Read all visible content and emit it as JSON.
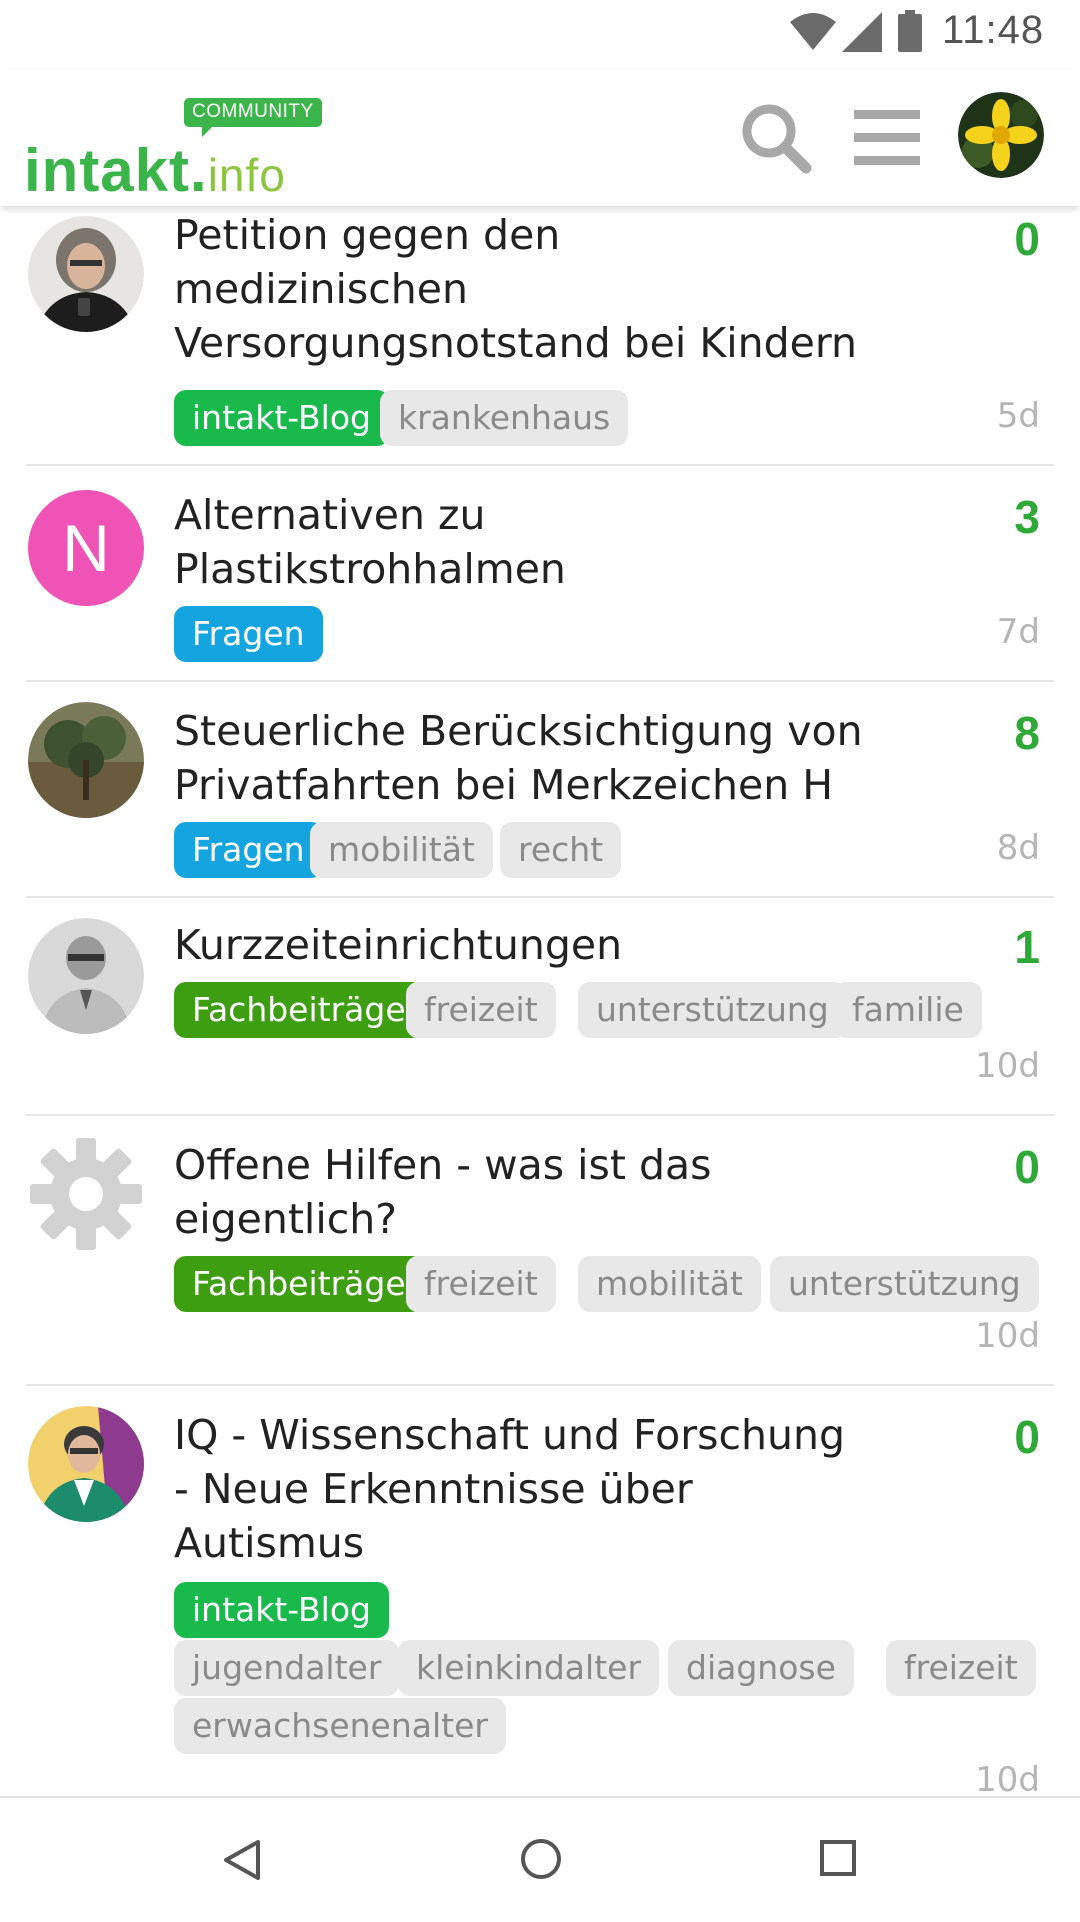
{
  "status_bar": {
    "time": "11:48"
  },
  "header": {
    "logo_badge": "COMMUNITY",
    "logo_main": "intakt",
    "logo_dot": ".",
    "logo_tld": "info",
    "icons": [
      "search-icon",
      "hamburger-menu-icon",
      "user-avatar"
    ]
  },
  "topics": [
    {
      "title": "Petition gegen den medizinischen Versorgungsnotstand bei Kindern",
      "title_lines": [
        "Petition gegen den",
        "medizinischen",
        "Versorgungsnotstand bei Kindern"
      ],
      "replies": "0",
      "age": "5d",
      "category": "intakt-Blog",
      "tags": [
        "krankenhaus"
      ]
    },
    {
      "title": "Alternativen zu Plastikstrohhalmen",
      "title_lines": [
        "Alternativen zu",
        "Plastikstrohhalmen"
      ],
      "replies": "3",
      "age": "7d",
      "avatar_letter": "N",
      "category": "Fragen",
      "tags": []
    },
    {
      "title": "Steuerliche Berücksichtigung von Privatfahrten bei Merkzeichen H",
      "title_lines": [
        "Steuerliche Berücksichtigung von",
        "Privatfahrten bei Merkzeichen H"
      ],
      "replies": "8",
      "age": "8d",
      "category": "Fragen",
      "tags": [
        "mobilität",
        "recht"
      ]
    },
    {
      "title": "Kurzzeiteinrichtungen",
      "title_lines": [
        "Kurzzeiteinrichtungen"
      ],
      "replies": "1",
      "age": "10d",
      "category": "Fachbeiträge",
      "tags": [
        "freizeit",
        "unterstützung",
        "familie"
      ]
    },
    {
      "title": "Offene Hilfen - was ist das eigentlich?",
      "title_lines": [
        "Offene Hilfen - was ist das",
        "eigentlich?"
      ],
      "replies": "0",
      "age": "10d",
      "category": "Fachbeiträge",
      "tags": [
        "freizeit",
        "mobilität",
        "unterstützung"
      ]
    },
    {
      "title": "IQ - Wissenschaft und Forschung - Neue Erkenntnisse über Autismus",
      "title_lines": [
        "IQ - Wissenschaft und Forschung",
        "- Neue Erkenntnisse über",
        "Autismus"
      ],
      "replies": "0",
      "age": "10d",
      "category": "intakt-Blog",
      "tags": [
        "jugendalter",
        "kleinkindalter",
        "diagnose",
        "freizeit",
        "erwachsenenalter"
      ]
    }
  ],
  "colors": {
    "brand_green": "#3bb54a",
    "reply_count_green": "#2ea836",
    "cat_intakt_blog": "#19b94c",
    "cat_fragen": "#14a5e0",
    "cat_fachbeitraege": "#3d9e12",
    "tag_bg": "#e8e8e8"
  },
  "nav_bar": {
    "icons": [
      "back-icon",
      "home-icon",
      "recent-apps-icon"
    ]
  }
}
